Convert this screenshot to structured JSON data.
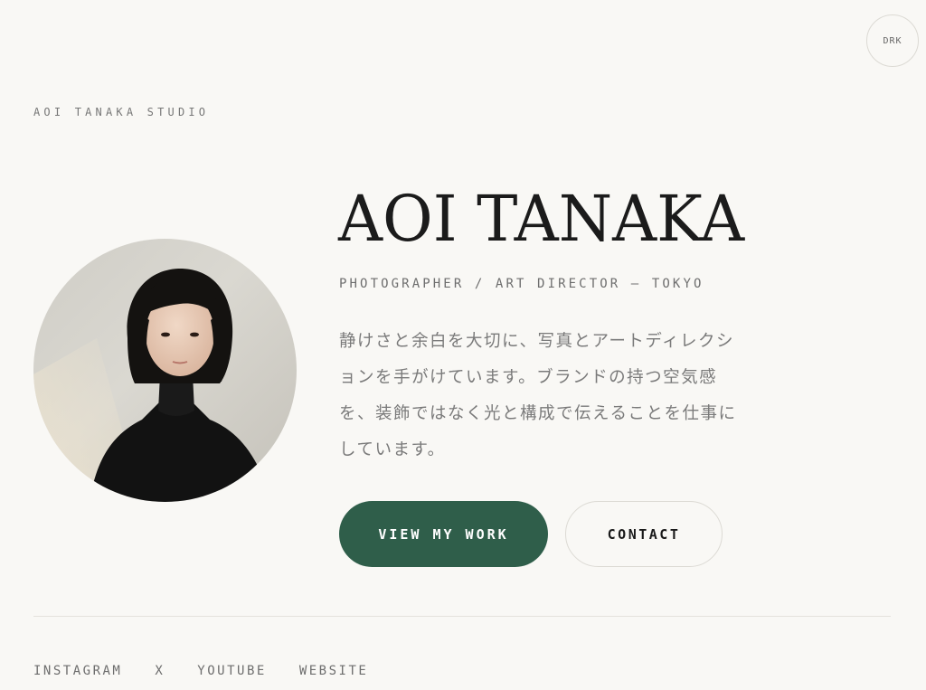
{
  "theme_toggle": {
    "label": "DRK"
  },
  "header": {
    "studio_name": "AOI TANAKA STUDIO"
  },
  "hero": {
    "name": "AOI TANAKA",
    "roles": "PHOTOGRAPHER / ART DIRECTOR — TOKYO",
    "bio_lines": [
      "静けさと余白を大切に、写真とアートディレクシ",
      "ョンを手がけています。ブランドの持つ空気感",
      "を、装飾ではなく光と構成で伝えることを仕事に",
      "しています。"
    ],
    "primary_button": "VIEW MY WORK",
    "secondary_button": "CONTACT"
  },
  "social_links": [
    "INSTAGRAM",
    "X",
    "YOUTUBE",
    "WEBSITE"
  ],
  "colors": {
    "background": "#f9f8f5",
    "accent": "#2f5e4a",
    "text": "#1b1b1b",
    "muted": "#6e6e6e",
    "border": "#dcdad4"
  }
}
